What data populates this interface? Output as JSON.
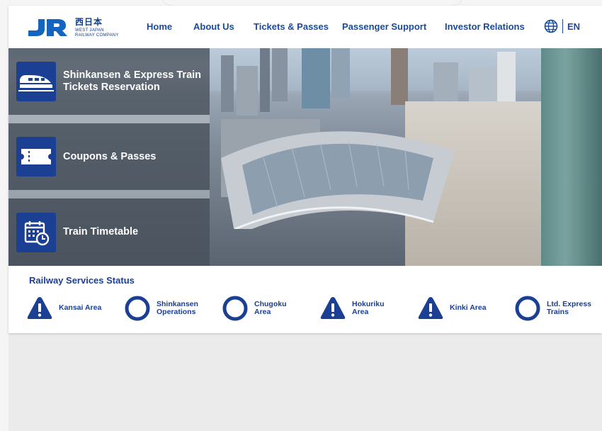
{
  "header": {
    "logo": {
      "mark": "JR",
      "kanji": "西日本",
      "sub_line1": "WEST JAPAN",
      "sub_line2": "RAILWAY COMPANY"
    },
    "nav": [
      "Home",
      "About Us",
      "Tickets & Passes",
      "Passenger Support",
      "Investor Relations"
    ],
    "language": {
      "icon": "globe-icon",
      "label": "EN"
    }
  },
  "hero": {
    "menu": [
      {
        "icon": "shinkansen-train-icon",
        "line1": "Shinkansen & Express Train",
        "line2": "Tickets Reservation"
      },
      {
        "icon": "ticket-icon",
        "line1": "Coupons & Passes",
        "line2": ""
      },
      {
        "icon": "timetable-calendar-icon",
        "line1": "Train Timetable",
        "line2": ""
      }
    ]
  },
  "status": {
    "title": "Railway Services Status",
    "items": [
      {
        "icon": "warning-triangle-icon",
        "line1": "Kansai Area",
        "line2": ""
      },
      {
        "icon": "normal-circle-icon",
        "line1": "Shinkansen",
        "line2": "Operations"
      },
      {
        "icon": "normal-circle-icon",
        "line1": "Chugoku",
        "line2": "Area"
      },
      {
        "icon": "warning-triangle-icon",
        "line1": "Hokuriku",
        "line2": "Area"
      },
      {
        "icon": "warning-triangle-icon",
        "line1": "Kinki Area",
        "line2": ""
      },
      {
        "icon": "normal-circle-icon",
        "line1": "Ltd. Express",
        "line2": "Trains"
      }
    ]
  },
  "colors": {
    "brand_blue": "#1a3f93",
    "nav_blue": "#1a4a9c",
    "menu_overlay": "#46505a"
  }
}
